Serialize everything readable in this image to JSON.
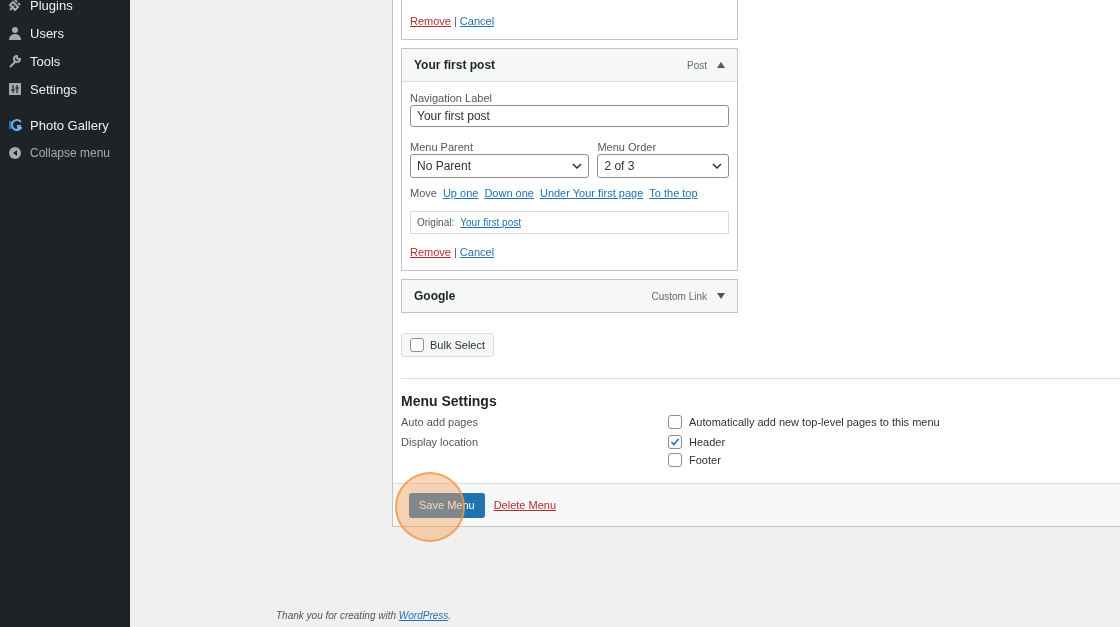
{
  "sidebar": {
    "items": [
      {
        "label": "Plugins",
        "kind": "link"
      },
      {
        "label": "Users",
        "kind": "link"
      },
      {
        "label": "Tools",
        "kind": "link"
      },
      {
        "label": "Settings",
        "kind": "link"
      },
      {
        "label": "Photo Gallery",
        "kind": "plugin"
      },
      {
        "label": "Collapse menu",
        "kind": "collapse"
      }
    ]
  },
  "menu_items": [
    {
      "remove": "Remove",
      "separator": "|",
      "cancel": "Cancel"
    },
    {
      "title": "Your first post",
      "type": "Post",
      "expanded": true,
      "nav_label": "Navigation Label",
      "nav_value": "Your first post",
      "parent_label": "Menu Parent",
      "parent_value": "No Parent",
      "order_label": "Menu Order",
      "order_value": "2 of 3",
      "move_label": "Move",
      "move_links": [
        "Up one",
        "Down one",
        "Under Your first page",
        "To the top"
      ],
      "original_label": "Original:",
      "original_link": "Your first post",
      "remove": "Remove",
      "separator": "|",
      "cancel": "Cancel"
    },
    {
      "title": "Google",
      "type": "Custom Link",
      "expanded": false
    }
  ],
  "bulk_select": {
    "label": "Bulk Select",
    "checked": false
  },
  "menu_settings": {
    "title": "Menu Settings",
    "rows": [
      {
        "label": "Auto add pages",
        "options": [
          {
            "label": "Automatically add new top-level pages to this menu",
            "checked": false
          }
        ]
      },
      {
        "label": "Display location",
        "options": [
          {
            "label": "Header",
            "checked": true
          },
          {
            "label": "Footer",
            "checked": false
          }
        ]
      }
    ]
  },
  "actions": {
    "save": "Save Menu",
    "delete": "Delete Menu",
    "highlighted": true
  },
  "footer": {
    "before": "Thank you for creating with",
    "link": "WordPress",
    "after": "."
  }
}
